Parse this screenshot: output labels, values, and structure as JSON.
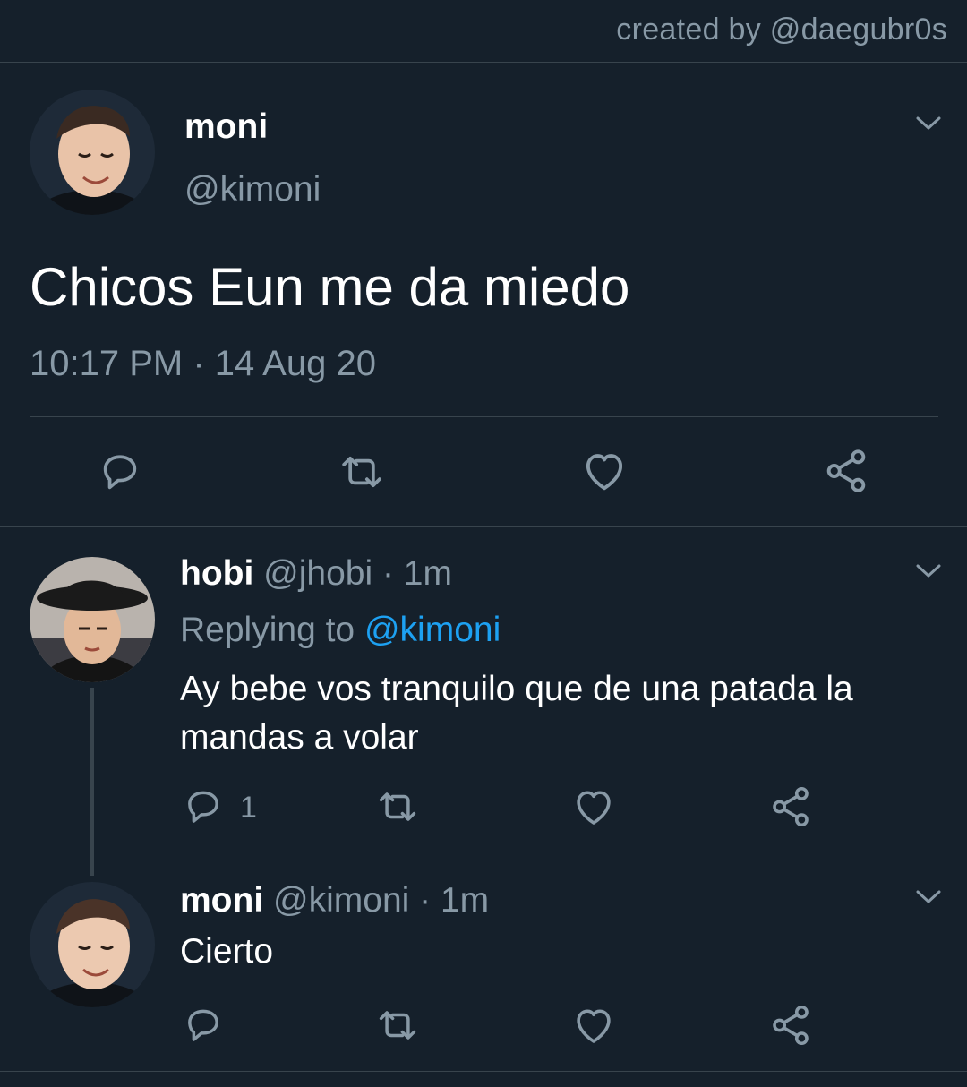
{
  "header": {
    "credit": "created by @daegubr0s"
  },
  "main_tweet": {
    "name": "moni",
    "handle": "@kimoni",
    "text": "Chicos Eun me da miedo",
    "timestamp": "10:17 PM · 14 Aug 20"
  },
  "replies": [
    {
      "name": "hobi",
      "handle_time": "@jhobi · 1m",
      "replying_prefix": "Replying to ",
      "replying_to": "@kimoni",
      "text_line1": "Ay bebe vos tranquilo que de una patada la",
      "text_line2": "mandas a volar",
      "reply_count": "1"
    },
    {
      "name": "moni",
      "handle_time": "@kimoni · 1m",
      "text": "Cierto"
    }
  ],
  "icons": {
    "reply": "reply-icon",
    "retweet": "retweet-icon",
    "like": "heart-icon",
    "share": "share-icon",
    "menu": "chevron-down-icon"
  },
  "colors": {
    "background": "#15202b",
    "muted": "#8899a6",
    "link": "#1da1f2",
    "divider": "#38444d"
  }
}
